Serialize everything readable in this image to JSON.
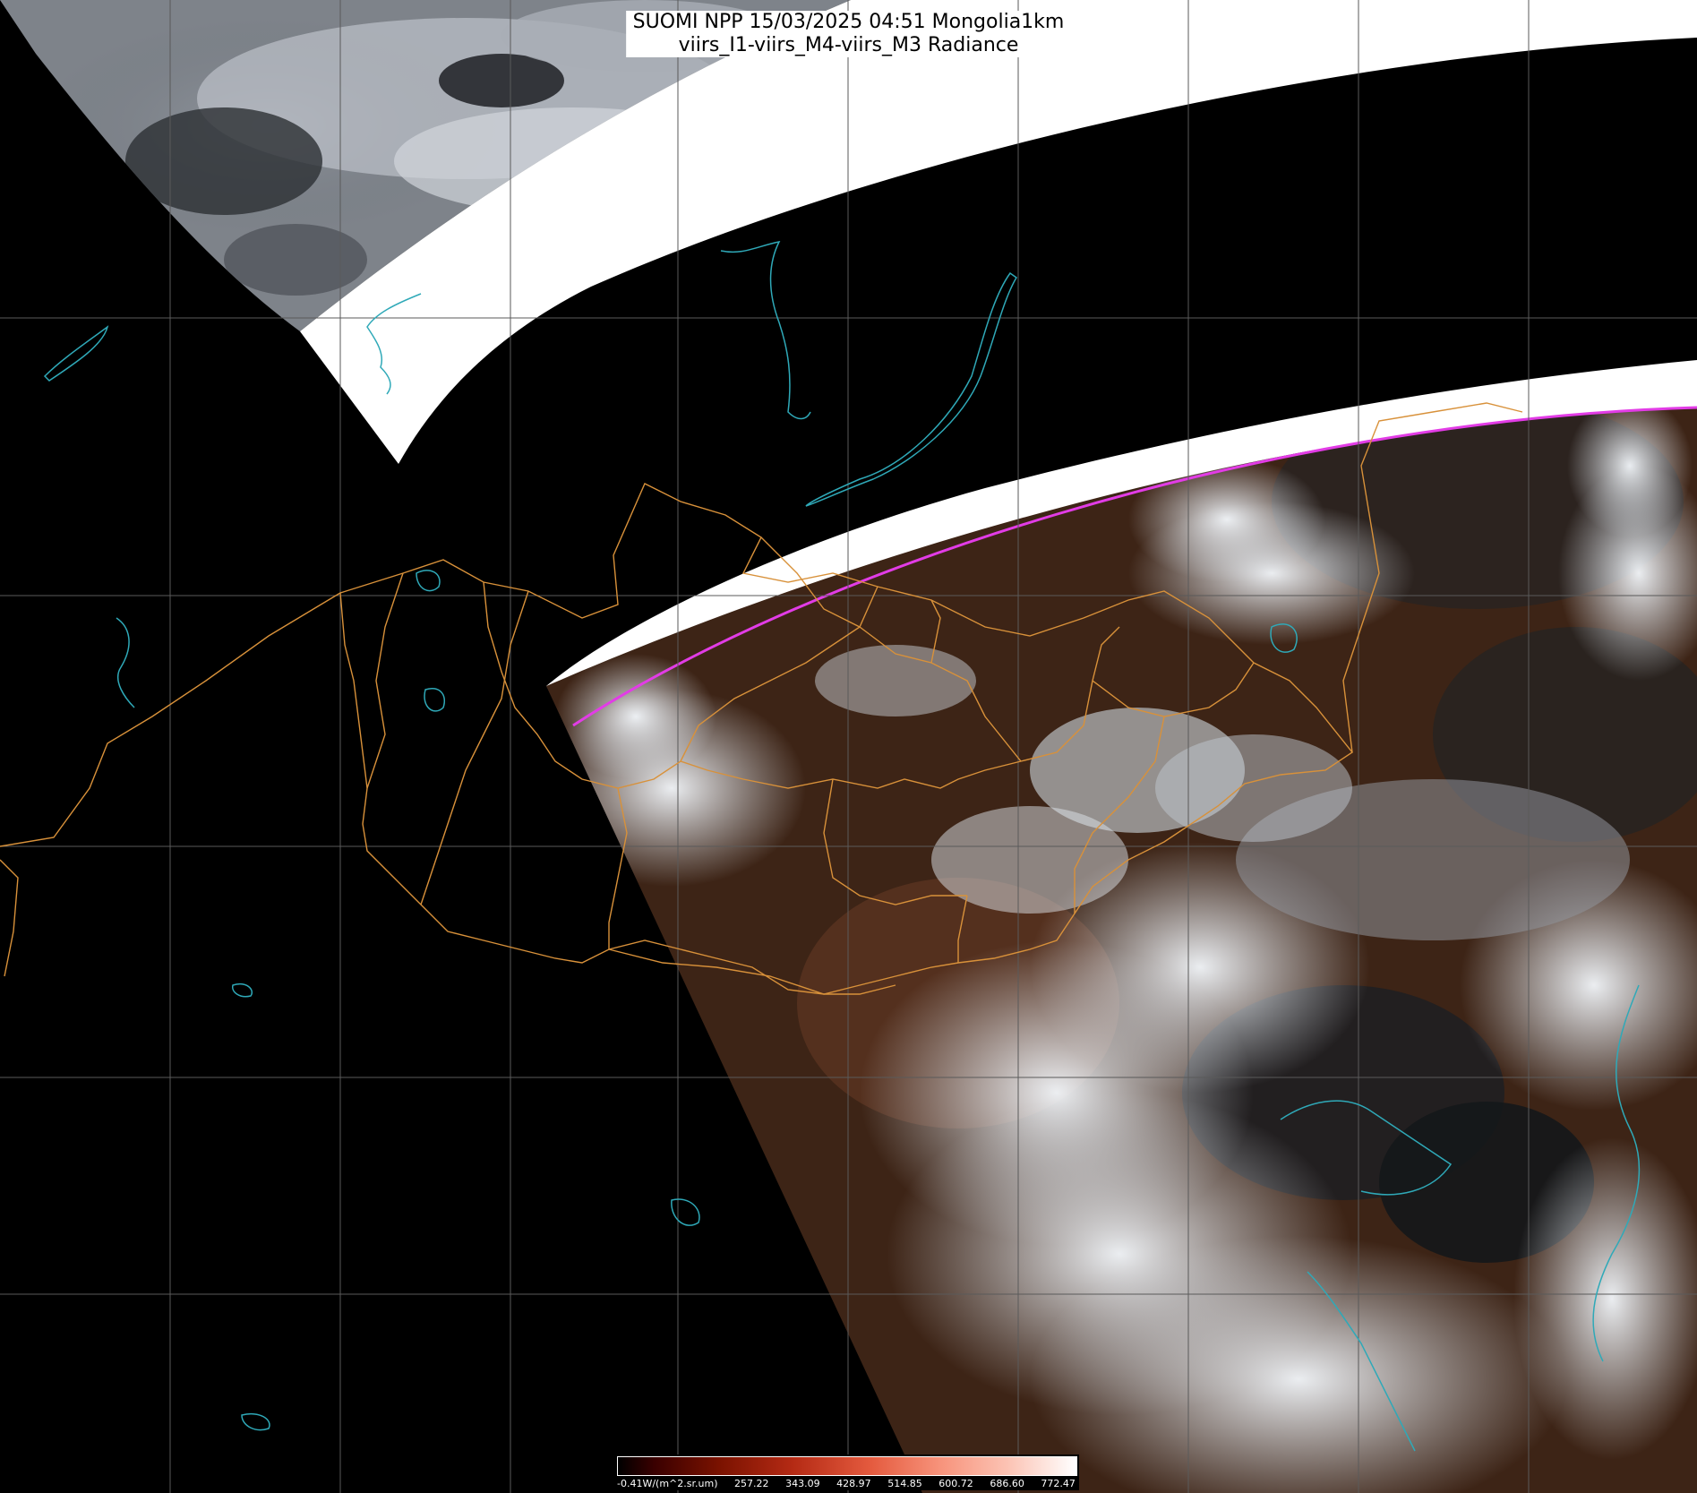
{
  "title": {
    "line1": "SUOMI NPP 15/03/2025 04:51 Mongolia1km",
    "line2": "viirs_I1-viirs_M4-viirs_M3 Radiance"
  },
  "colorbar": {
    "labels": [
      "-0.41W/(m^2.sr.um)",
      "257.22",
      "343.09",
      "428.97",
      "514.85",
      "600.72",
      "686.60",
      "772.47"
    ]
  },
  "colors": {
    "background": "#000000",
    "swath_gap": "#ffffff",
    "grid": "#5a5a5a",
    "admin_boundary": "#d8913a",
    "coastline_water": "#2fa9b8",
    "swath_edge": "#e23ce6",
    "land": "#3d2416",
    "cloud": "#eef3f8"
  }
}
